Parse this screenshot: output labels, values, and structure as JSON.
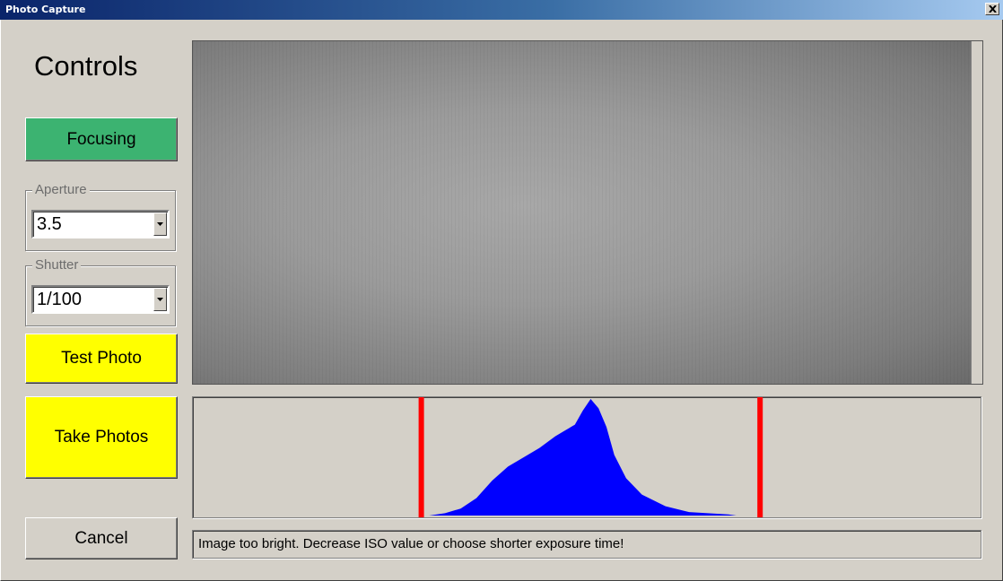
{
  "window": {
    "title": "Photo Capture"
  },
  "controls": {
    "heading": "Controls",
    "focusing_label": "Focusing",
    "aperture_label": "Aperture",
    "aperture_value": "3.5",
    "shutter_label": "Shutter",
    "shutter_value": "1/100",
    "test_photo_label": "Test Photo",
    "take_photos_label": "Take Photos",
    "cancel_label": "Cancel"
  },
  "colors": {
    "focusing_button": "#3cb371",
    "photo_buttons": "#ffff00",
    "histogram_fill": "#0000ff",
    "limit_markers": "#ff0000"
  },
  "status": {
    "message": "Image too bright. Decrease ISO value or choose shorter exposure time!"
  },
  "histogram": {
    "lower_limit": 0.29,
    "upper_limit": 0.72,
    "curve": [
      [
        0.3,
        0.0
      ],
      [
        0.32,
        0.02
      ],
      [
        0.34,
        0.06
      ],
      [
        0.36,
        0.15
      ],
      [
        0.38,
        0.3
      ],
      [
        0.4,
        0.42
      ],
      [
        0.42,
        0.5
      ],
      [
        0.44,
        0.58
      ],
      [
        0.46,
        0.68
      ],
      [
        0.47,
        0.72
      ],
      [
        0.485,
        0.78
      ],
      [
        0.495,
        0.9
      ],
      [
        0.505,
        1.0
      ],
      [
        0.515,
        0.92
      ],
      [
        0.525,
        0.76
      ],
      [
        0.535,
        0.52
      ],
      [
        0.55,
        0.32
      ],
      [
        0.57,
        0.18
      ],
      [
        0.6,
        0.08
      ],
      [
        0.63,
        0.03
      ],
      [
        0.68,
        0.01
      ],
      [
        0.69,
        0.0
      ]
    ]
  }
}
